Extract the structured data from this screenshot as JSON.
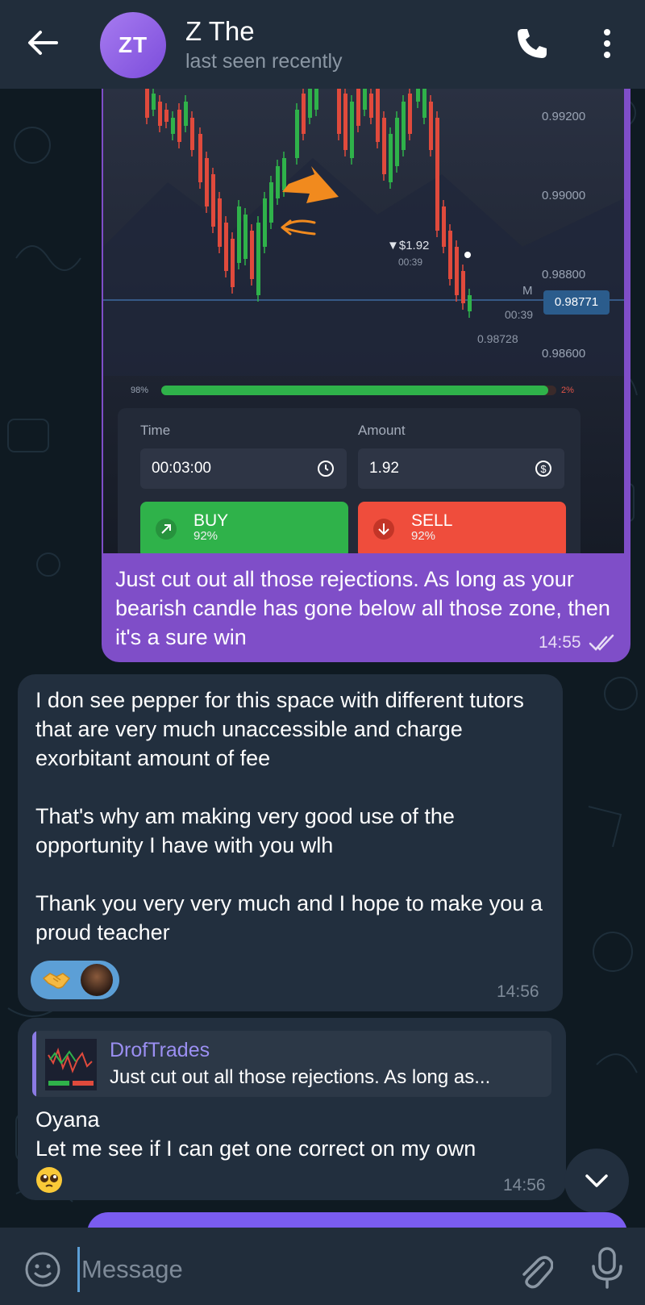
{
  "header": {
    "avatar_initials": "ZT",
    "name": "Z The",
    "status": "last seen recently",
    "icons": [
      "back-arrow-icon",
      "phone-icon",
      "more-vertical-icon"
    ]
  },
  "colors": {
    "outgoing_bubble": "#7f4ec8",
    "incoming_bubble": "#222f3e",
    "header": "#212d3b",
    "accent": "#5c9fd6"
  },
  "chart_screenshot": {
    "price_labels": [
      "0.99200",
      "0.99000",
      "0.98800",
      "0.98600"
    ],
    "current_price": "0.98771",
    "low_price": "0.98728",
    "profit": "▼$1.92",
    "profit_timer": "00:39",
    "expiry_timer": "00:39",
    "marker": "M",
    "buy_percent_bar": "98%",
    "sell_percent_bar": "2%",
    "buy_share": 0.98,
    "time_label": "Time",
    "time_value": "00:03:00",
    "amount_label": "Amount",
    "amount_value": "1.92",
    "buy_label": "BUY",
    "buy_payout": "92%",
    "sell_label": "SELL",
    "sell_payout": "92%"
  },
  "messages": [
    {
      "direction": "out",
      "text": "Just cut out all those rejections. As long as your bearish candle has gone below all those zone, then it's a sure win",
      "time": "14:55"
    },
    {
      "direction": "in",
      "text": "I don see pepper for this space with different tutors that are very much unaccessible and charge exorbitant amount of fee\n\nThat's why am making very good use of the opportunity I have with you wlh\n\nThank you very very much and I hope to make you a proud teacher",
      "time": "14:56",
      "reaction": "handshake-emoji"
    },
    {
      "direction": "in",
      "reply_name": "DrofTrades",
      "reply_text": "Just cut out all those rejections. As long as...",
      "text": "Oyana\nLet me see if I can get one correct on my own",
      "emoji": "pleading-face-emoji",
      "time": "14:56"
    }
  ],
  "input": {
    "placeholder": "Message"
  }
}
